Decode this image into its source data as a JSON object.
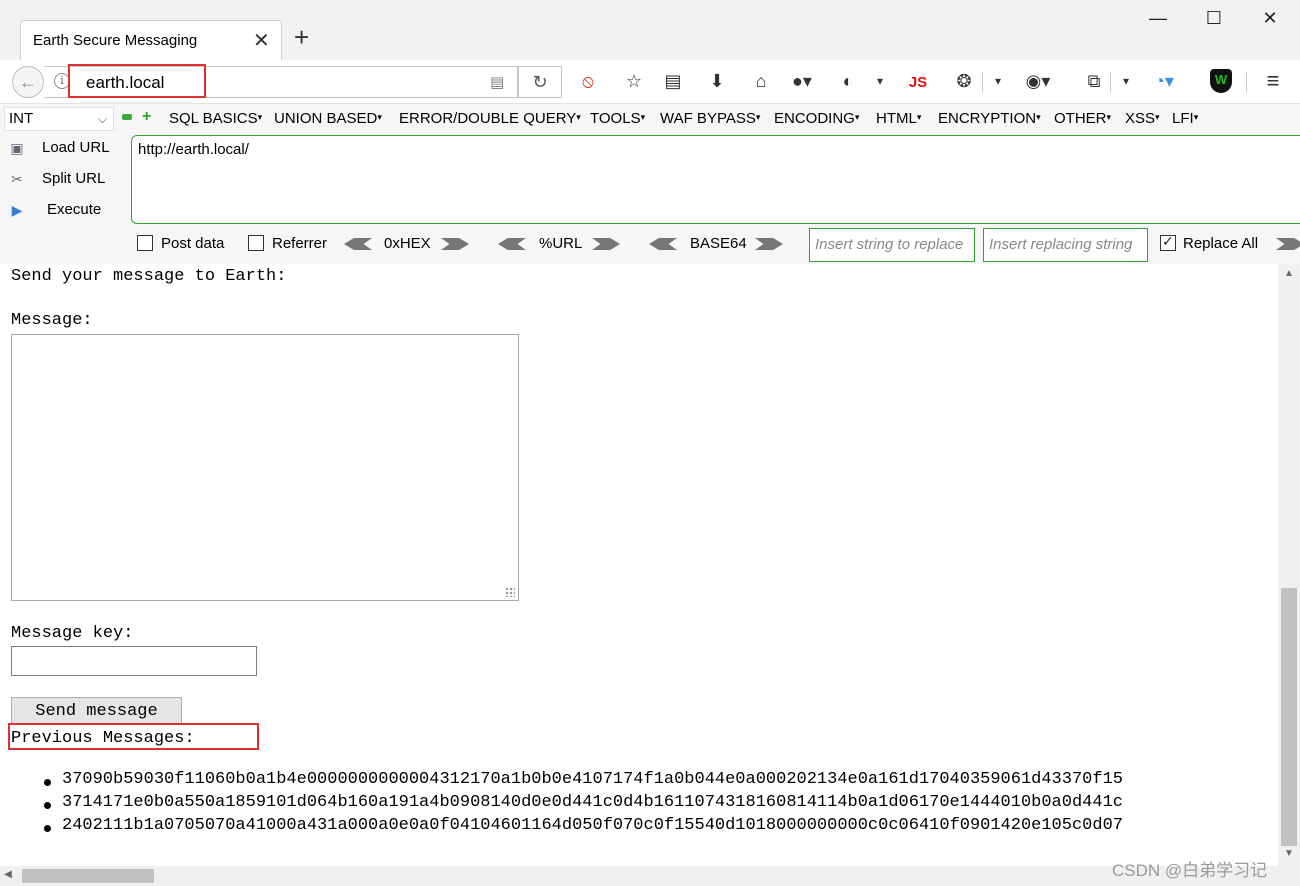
{
  "window": {
    "tab_title": "Earth Secure Messaging",
    "new_tab_icon": "+",
    "close_tab_icon": "✕",
    "minimize_icon": "—",
    "maximize_icon": "☐",
    "close_icon": "✕"
  },
  "nav": {
    "url": "earth.local",
    "highlight_color": "#e03030",
    "toolbar_icons": [
      "no-script-icon",
      "bookmark-star-icon",
      "reader-list-icon",
      "download-icon",
      "home-icon",
      "globe-icon",
      "cookie-icon",
      "js-icon",
      "bug-icon",
      "proxy-icon",
      "resize-icon",
      "chrome-icon",
      "wappalyzer-shield-icon",
      "menu-icon"
    ],
    "js_label": "JS"
  },
  "hackbar": {
    "type_select": "INT",
    "menus": [
      "SQL BASICS",
      "UNION BASED",
      "ERROR/DOUBLE QUERY",
      "TOOLS",
      "WAF BYPASS",
      "ENCODING",
      "HTML",
      "ENCRYPTION",
      "OTHER",
      "XSS",
      "LFI"
    ],
    "actions": {
      "load_url": "Load URL",
      "split_url": "Split URL",
      "execute": "Execute"
    },
    "url_value": "http://earth.local/",
    "options": {
      "post_data": "Post data",
      "referrer": "Referrer",
      "hex": "0xHEX",
      "url": "%URL",
      "base64": "BASE64",
      "replace_placeholder": "Insert string to replace",
      "replacing_placeholder": "Insert replacing string",
      "replace_all": "Replace All",
      "replace_all_checked": true
    },
    "accent_color": "#33a033"
  },
  "page": {
    "heading": "Send your message to Earth:",
    "message_label": "Message:",
    "key_label": "Message key:",
    "send_button": "Send message",
    "previous_label": "Previous Messages:",
    "previous_messages": [
      "37090b59030f11060b0a1b4e0000000000004312170a1b0b0e4107174f1a0b044e0a000202134e0a161d17040359061d43370f15",
      "3714171e0b0a550a1859101d064b160a191a4b0908140d0e0d441c0d4b1611074318160814114b0a1d06170e1444010b0a0d441c",
      "2402111b1a0705070a41000a431a000a0e0a0f04104601164d050f070c0f15540d1018000000000c0c06410f0901420e105c0d07"
    ]
  },
  "watermark": "CSDN @白弟学习记"
}
